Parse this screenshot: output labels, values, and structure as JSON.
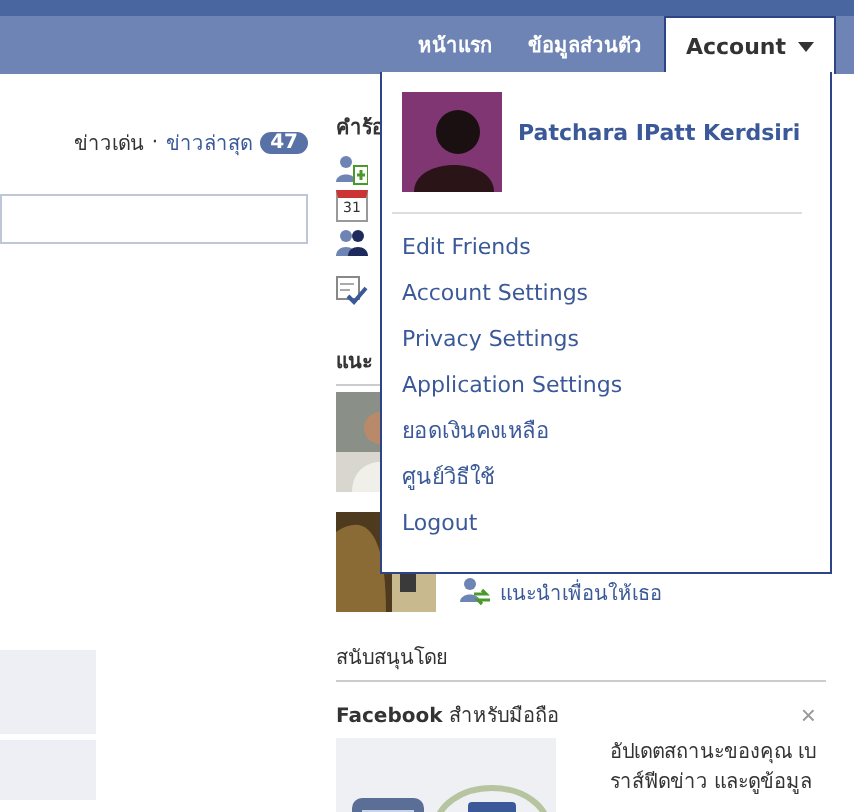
{
  "nav": {
    "items": [
      {
        "label": "หน้าแรก"
      },
      {
        "label": "ข้อมูลส่วนตัว"
      }
    ],
    "account": {
      "label": "Account",
      "expanded": true
    }
  },
  "menu": {
    "user": {
      "name": "Patchara IPatt Kerdsiri"
    },
    "items": [
      {
        "label": "Edit Friends"
      },
      {
        "label": "Account Settings"
      },
      {
        "label": "Privacy Settings"
      },
      {
        "label": "Application Settings"
      },
      {
        "label": "ยอดเงินคงเหลือ"
      },
      {
        "label": "ศูนย์วิธีใช้"
      },
      {
        "label": "Logout"
      }
    ]
  },
  "feed": {
    "separator": "·",
    "tabs": [
      {
        "label": "ข่าวเด่น",
        "selected": true
      },
      {
        "label": "ข่าวล่าสุด",
        "selected": false,
        "count": "47"
      }
    ]
  },
  "sidebar": {
    "requests_heading": "คำร้อ",
    "request_icons": [
      {
        "kind": "add-friend"
      },
      {
        "kind": "calendar",
        "day": "31"
      },
      {
        "kind": "people"
      },
      {
        "kind": "checklist"
      }
    ],
    "suggest_heading": "แนะ",
    "suggest_link": "แนะนำเพื่อนให้เธอ",
    "sponsored_heading": "สนับสนุนโดย",
    "ad": {
      "title": "**Facebook** สำหรับมือถือ",
      "close": "×",
      "text": "อัปเดตสถานะของคุณ เบราส์ฟีดข่าว และดูข้อมูล"
    }
  }
}
